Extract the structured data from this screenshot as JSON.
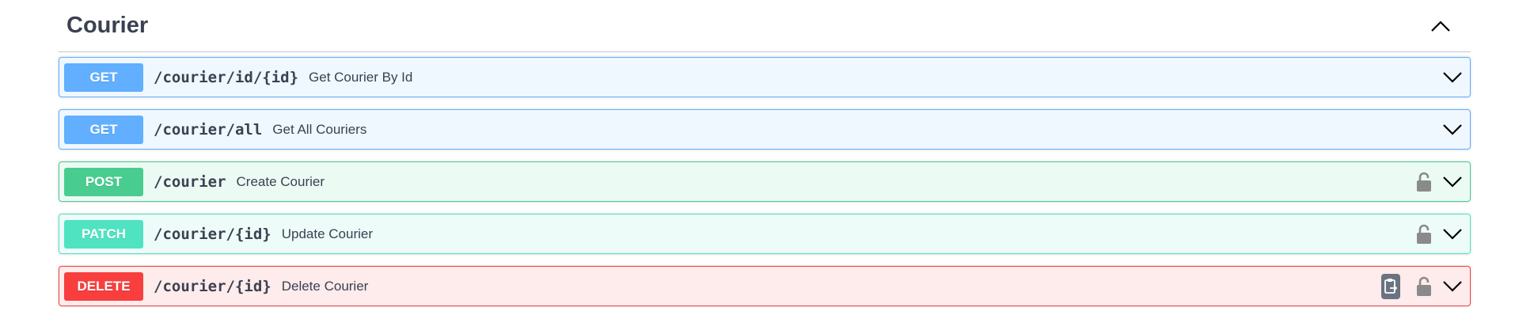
{
  "tag": {
    "title": "Courier",
    "toggle_icon": "chevron-up-icon"
  },
  "colors": {
    "get": "#61affe",
    "post": "#49cc90",
    "patch": "#50e3c2",
    "delete": "#f93e3e"
  },
  "operations": [
    {
      "method": "GET",
      "path": "/courier/id/{id}",
      "summary": "Get Courier By Id",
      "locked": false,
      "copy": false
    },
    {
      "method": "GET",
      "path": "/courier/all",
      "summary": "Get All Couriers",
      "locked": false,
      "copy": false
    },
    {
      "method": "POST",
      "path": "/courier",
      "summary": "Create Courier",
      "locked": true,
      "copy": false
    },
    {
      "method": "PATCH",
      "path": "/courier/{id}",
      "summary": "Update Courier",
      "locked": true,
      "copy": false
    },
    {
      "method": "DELETE",
      "path": "/courier/{id}",
      "summary": "Delete Courier",
      "locked": true,
      "copy": true
    }
  ]
}
